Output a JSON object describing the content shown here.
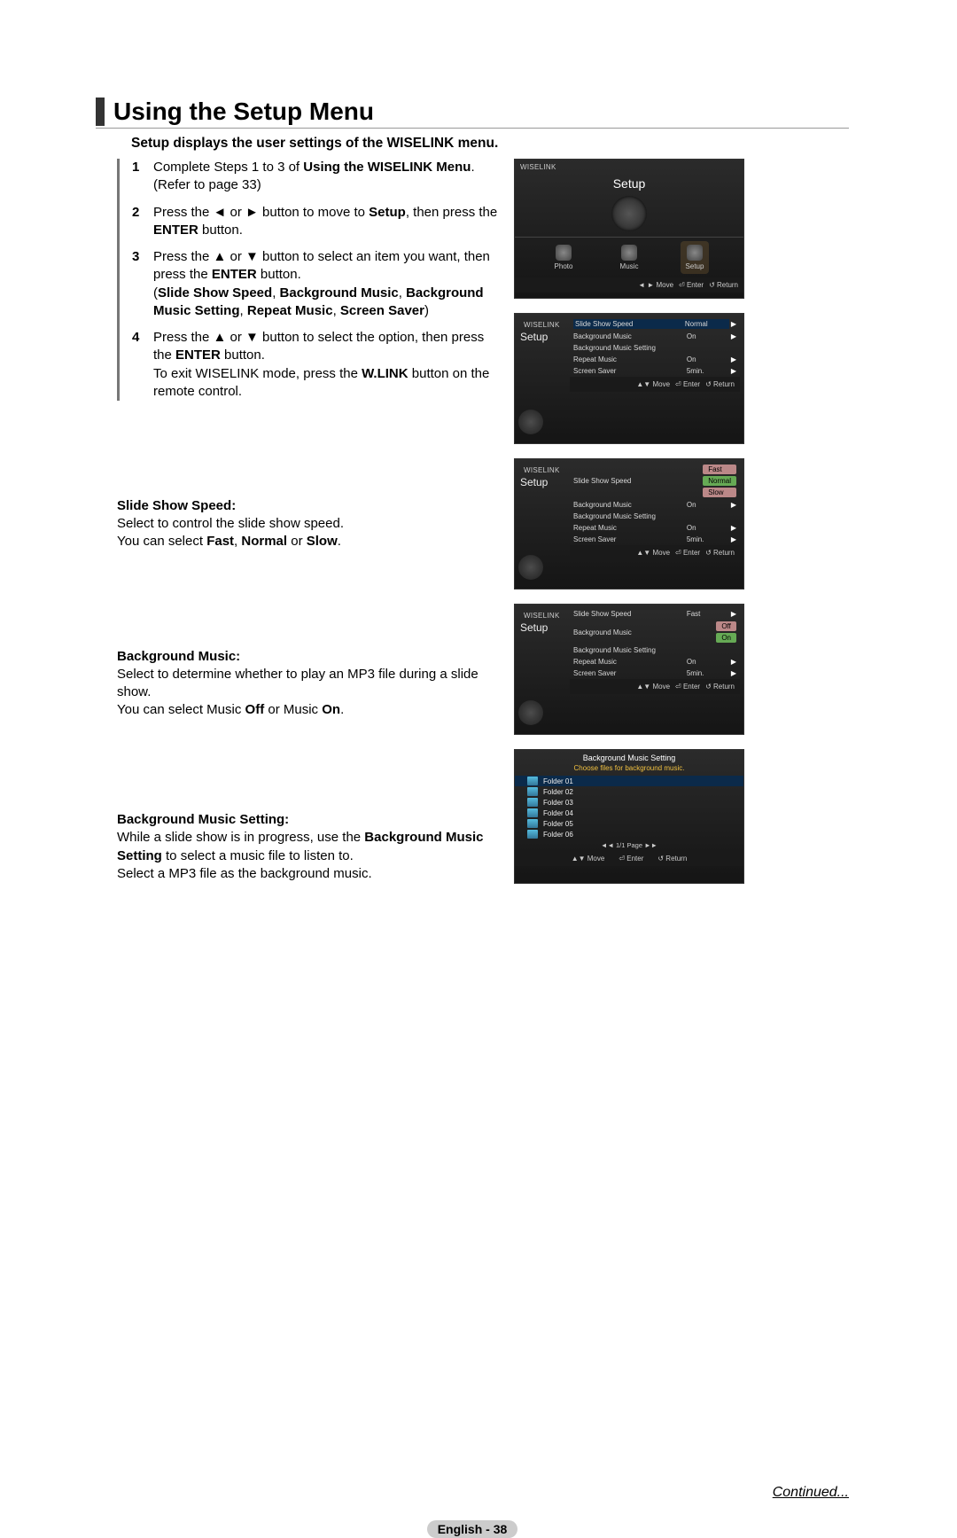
{
  "title": "Using the Setup Menu",
  "intro": "Setup displays the user settings of the WISELINK menu.",
  "steps": [
    {
      "n": "1",
      "pre": "Complete Steps 1 to 3 of ",
      "bold1": "Using the WISELINK Menu",
      "post1": ". (Refer to page 33)"
    },
    {
      "n": "2",
      "pre": "Press the ◄ or ► button to move to ",
      "bold1": "Setup",
      "post1": ", then press the ",
      "bold2": "ENTER",
      "post2": " button."
    },
    {
      "n": "3",
      "pre": "Press the ▲ or ▼ button to select an item you want, then press the ",
      "bold1": "ENTER",
      "post1": " button.\n(",
      "bold2": "Slide Show Speed",
      "post2": ", ",
      "bold3": "Background Music",
      "post3": ", ",
      "bold4": "Background Music Setting",
      "post4": ", ",
      "bold5": "Repeat Music",
      "post5": ", ",
      "bold6": "Screen Saver",
      "post6": ")"
    },
    {
      "n": "4",
      "pre": "Press the ▲ or ▼ button to select the option, then press the ",
      "bold1": "ENTER",
      "post1": " button.\nTo exit WISELINK mode, press the ",
      "bold2": "W.LINK",
      "post2": " button on the remote control."
    }
  ],
  "sections": [
    {
      "label": "Slide Show Speed:",
      "body_pre": "Select to control the slide show speed.\nYou can select ",
      "b1": "Fast",
      "m1": ", ",
      "b2": "Normal",
      "m2": " or ",
      "b3": "Slow",
      "post": "."
    },
    {
      "label": "Background Music:",
      "body_pre": "Select to determine whether to play an MP3 file during a slide show.\nYou can select Music ",
      "b1": "Off",
      "m1": " or Music ",
      "b2": "On",
      "m2": "",
      "b3": "",
      "post": "."
    },
    {
      "label": "Background Music Setting:",
      "body_pre": "While a slide show is in progress, use the ",
      "b1": "Background Music Setting",
      "m1": " to select a music file to listen to.\nSelect a MP3 file as the background music.",
      "b2": "",
      "m2": "",
      "b3": "",
      "post": ""
    }
  ],
  "brand": "WISELINK",
  "panel_top": {
    "title": "Setup",
    "tabs": [
      "Photo",
      "Music",
      "Setup"
    ],
    "footer": {
      "move": "◄ ► Move",
      "enter": "⏎ Enter",
      "return": "↺ Return"
    }
  },
  "panel_list": {
    "side": "Setup",
    "rows": [
      {
        "label": "Slide Show Speed",
        "val": "Normal",
        "sel": true
      },
      {
        "label": "Background Music",
        "val": "On"
      },
      {
        "label": "Background Music Setting",
        "val": ""
      },
      {
        "label": "Repeat Music",
        "val": "On"
      },
      {
        "label": "Screen Saver",
        "val": "5min."
      }
    ],
    "footer": {
      "move": "▲▼ Move",
      "enter": "⏎ Enter",
      "return": "↺ Return"
    }
  },
  "panel_speed": {
    "side": "Setup",
    "rows": [
      {
        "label": "Slide Show Speed",
        "opts": [
          "Fast",
          "Normal",
          "Slow"
        ],
        "sel": 1
      },
      {
        "label": "Background Music",
        "val": "On"
      },
      {
        "label": "Background Music Setting",
        "val": ""
      },
      {
        "label": "Repeat Music",
        "val": "On"
      },
      {
        "label": "Screen Saver",
        "val": "5min."
      }
    ],
    "footer": {
      "move": "▲▼ Move",
      "enter": "⏎ Enter",
      "return": "↺ Return"
    }
  },
  "panel_bgm": {
    "side": "Setup",
    "rows": [
      {
        "label": "Slide Show Speed",
        "val": "Fast"
      },
      {
        "label": "Background Music",
        "opts": [
          "Off",
          "On"
        ],
        "sel": 1
      },
      {
        "label": "Background Music Setting",
        "val": ""
      },
      {
        "label": "Repeat Music",
        "val": "On"
      },
      {
        "label": "Screen Saver",
        "val": "5min."
      }
    ],
    "footer": {
      "move": "▲▼ Move",
      "enter": "⏎ Enter",
      "return": "↺ Return"
    }
  },
  "panel_folders": {
    "title": "Background Music Setting",
    "sub": "Choose files for background music.",
    "items": [
      "Folder 01",
      "Folder 02",
      "Folder 03",
      "Folder 04",
      "Folder 05",
      "Folder 06"
    ],
    "page": "◄◄ 1/1 Page ►►",
    "footer": {
      "move": "▲▼ Move",
      "enter": "⏎ Enter",
      "return": "↺ Return"
    }
  },
  "continued": "Continued...",
  "page_lang": "English - 38"
}
